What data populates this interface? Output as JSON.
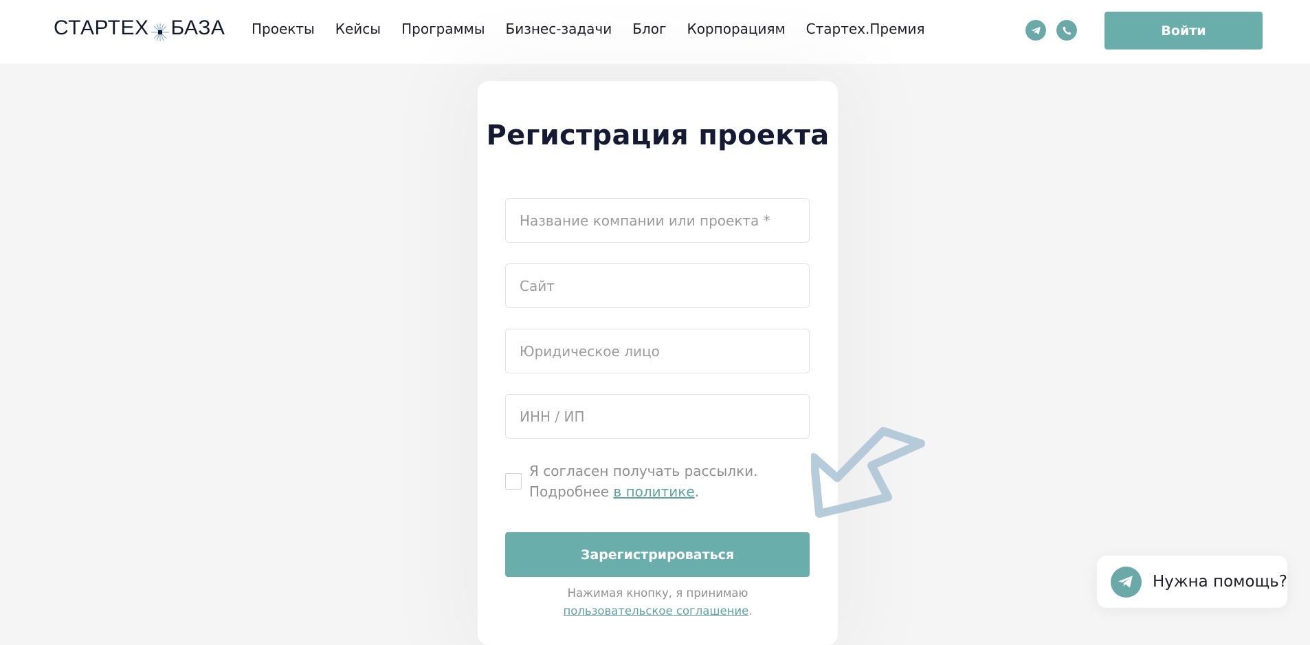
{
  "header": {
    "logo_left": "СТАРТЕХ",
    "logo_right": "БАЗА",
    "nav": [
      "Проекты",
      "Кейсы",
      "Программы",
      "Бизнес-задачи",
      "Блог",
      "Корпорациям",
      "Стартех.Премия"
    ],
    "social_icons": [
      "telegram-icon",
      "phone-icon"
    ],
    "login_label": "Войти"
  },
  "form": {
    "title": "Регистрация проекта",
    "fields": [
      {
        "placeholder": "Название компании или проекта *",
        "value": ""
      },
      {
        "placeholder": "Сайт",
        "value": ""
      },
      {
        "placeholder": "Юридическое лицо",
        "value": ""
      },
      {
        "placeholder": "ИНН / ИП",
        "value": ""
      }
    ],
    "consent_text": "Я согласен получать рассылки. Подробнее",
    "consent_link": "в политике",
    "consent_suffix": ".",
    "submit_label": "Зарегистрироваться",
    "terms_text": "Нажимая кнопку, я принимаю",
    "terms_link": "пользовательское соглашение",
    "terms_suffix": "."
  },
  "help_widget": {
    "label": "Нужна помощь?",
    "icon": "telegram-icon"
  },
  "colors": {
    "accent": "#6aaeab",
    "page_bg": "#f5f5f5",
    "title": "#141a33"
  }
}
